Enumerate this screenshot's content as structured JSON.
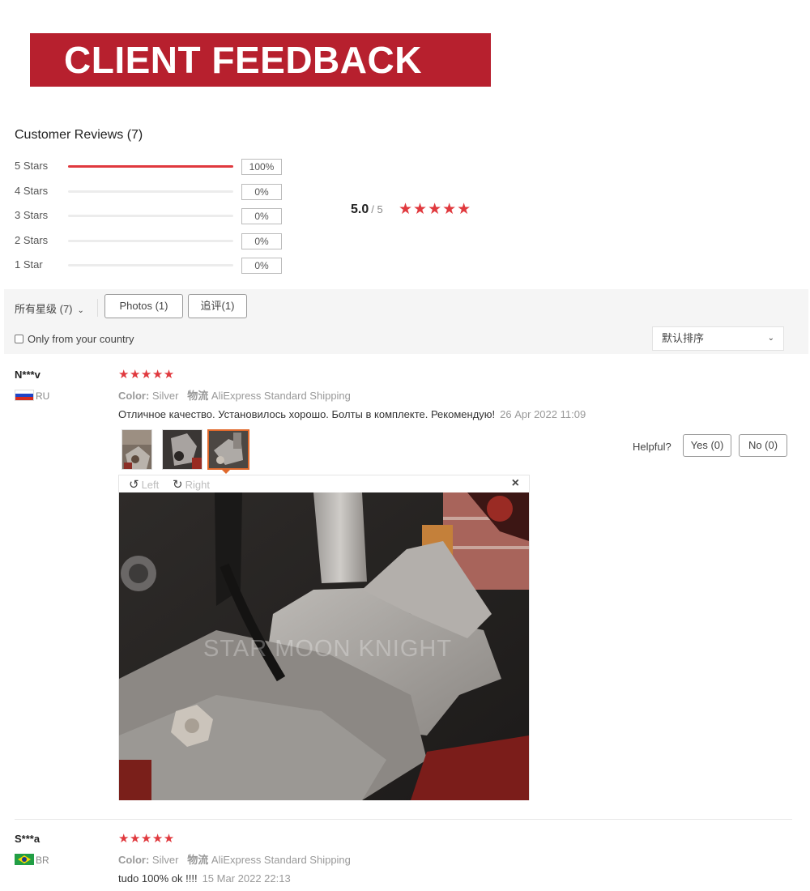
{
  "banner": {
    "title": "CLIENT FEEDBACK"
  },
  "summary": {
    "title": "Customer Reviews (7)",
    "distribution": [
      {
        "label": "5 Stars",
        "percent": "100%",
        "fraction": 1.0
      },
      {
        "label": "4 Stars",
        "percent": "0%",
        "fraction": 0
      },
      {
        "label": "3 Stars",
        "percent": "0%",
        "fraction": 0
      },
      {
        "label": "2 Stars",
        "percent": "0%",
        "fraction": 0
      },
      {
        "label": "1 Star",
        "percent": "0%",
        "fraction": 0
      }
    ],
    "average": "5.0",
    "out_of": "/ 5",
    "average_stars": "★★★★★"
  },
  "filters": {
    "rating_select": "所有星级 (7)",
    "photos_button": "Photos (1)",
    "followup_button": "追评(1)",
    "country_checkbox": "Only from your country",
    "sort_select": "默认排序"
  },
  "reviews": [
    {
      "user": "N***v",
      "country": "RU",
      "stars": "★★★★★",
      "color_key": "Color:",
      "color_value": "Silver",
      "shipping_key": "物流",
      "shipping_value": "AliExpress Standard Shipping",
      "text": "Отличное качество. Установилось хорошо. Болты в комплекте. Рекомендую!",
      "date": "26 Apr 2022 11:09",
      "helpful_label": "Helpful?",
      "yes_label": "Yes (0)",
      "no_label": "No (0)",
      "viewer": {
        "rotate_left": "Left",
        "rotate_right": "Right",
        "close": "×",
        "watermark": "STAR MOON KNIGHT"
      }
    },
    {
      "user": "S***a",
      "country": "BR",
      "stars": "★★★★★",
      "color_key": "Color:",
      "color_value": "Silver",
      "shipping_key": "物流",
      "shipping_value": "AliExpress Standard Shipping",
      "text": "tudo 100% ok !!!!",
      "date": "15 Mar 2022 22:13"
    }
  ],
  "colors": {
    "banner": "#b7202e",
    "star": "#e0393e",
    "accent": "#e0692c"
  }
}
